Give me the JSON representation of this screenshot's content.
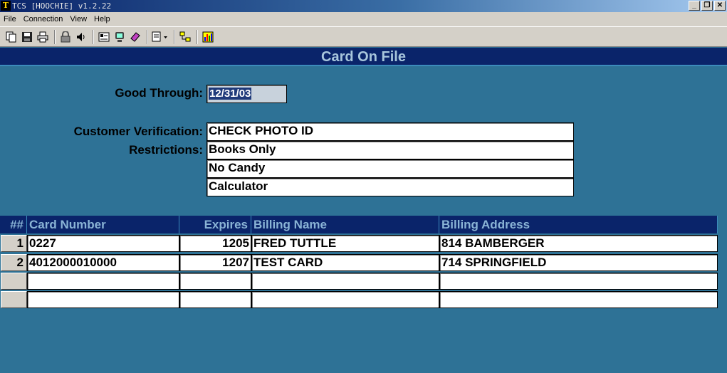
{
  "window": {
    "title": "TCS [HOOCHIE]  v1.2.22",
    "icon_letter": "T",
    "buttons": [
      "_",
      "❐",
      "✕"
    ]
  },
  "menu": [
    "File",
    "Connection",
    "View",
    "Help"
  ],
  "toolbar_icons": [
    "copy-icon",
    "save-icon",
    "print-icon",
    "lock-icon",
    "sound-icon",
    "properties-icon",
    "monitor-icon",
    "book-icon",
    "dropdown-doc-icon",
    "network-icon",
    "chart-icon"
  ],
  "header": {
    "title": "Card On File"
  },
  "form": {
    "good_through_label": "Good Through:",
    "good_through_value": "12/31/03",
    "verification_label": "Customer Verification:",
    "verification_value": "CHECK PHOTO ID",
    "restrictions_label": "Restrictions:",
    "restrictions": [
      "Books Only",
      "No Candy",
      "Calculator"
    ]
  },
  "grid": {
    "columns": [
      "##",
      "Card Number",
      "Expires",
      "Billing Name",
      "Billing Address"
    ],
    "rows": [
      {
        "num": "1",
        "card_number": "0227",
        "expires": "1205",
        "billing_name": "FRED TUTTLE",
        "billing_address": "814 BAMBERGER"
      },
      {
        "num": "2",
        "card_number": "4012000010000",
        "expires": "1207",
        "billing_name": "TEST CARD",
        "billing_address": "714 SPRINGFIELD"
      },
      {
        "num": "",
        "card_number": "",
        "expires": "",
        "billing_name": "",
        "billing_address": ""
      },
      {
        "num": "",
        "card_number": "",
        "expires": "",
        "billing_name": "",
        "billing_address": ""
      }
    ]
  },
  "colors": {
    "background": "#2e7296",
    "header": "#0a246a",
    "header_text": "#a8c6dc"
  }
}
